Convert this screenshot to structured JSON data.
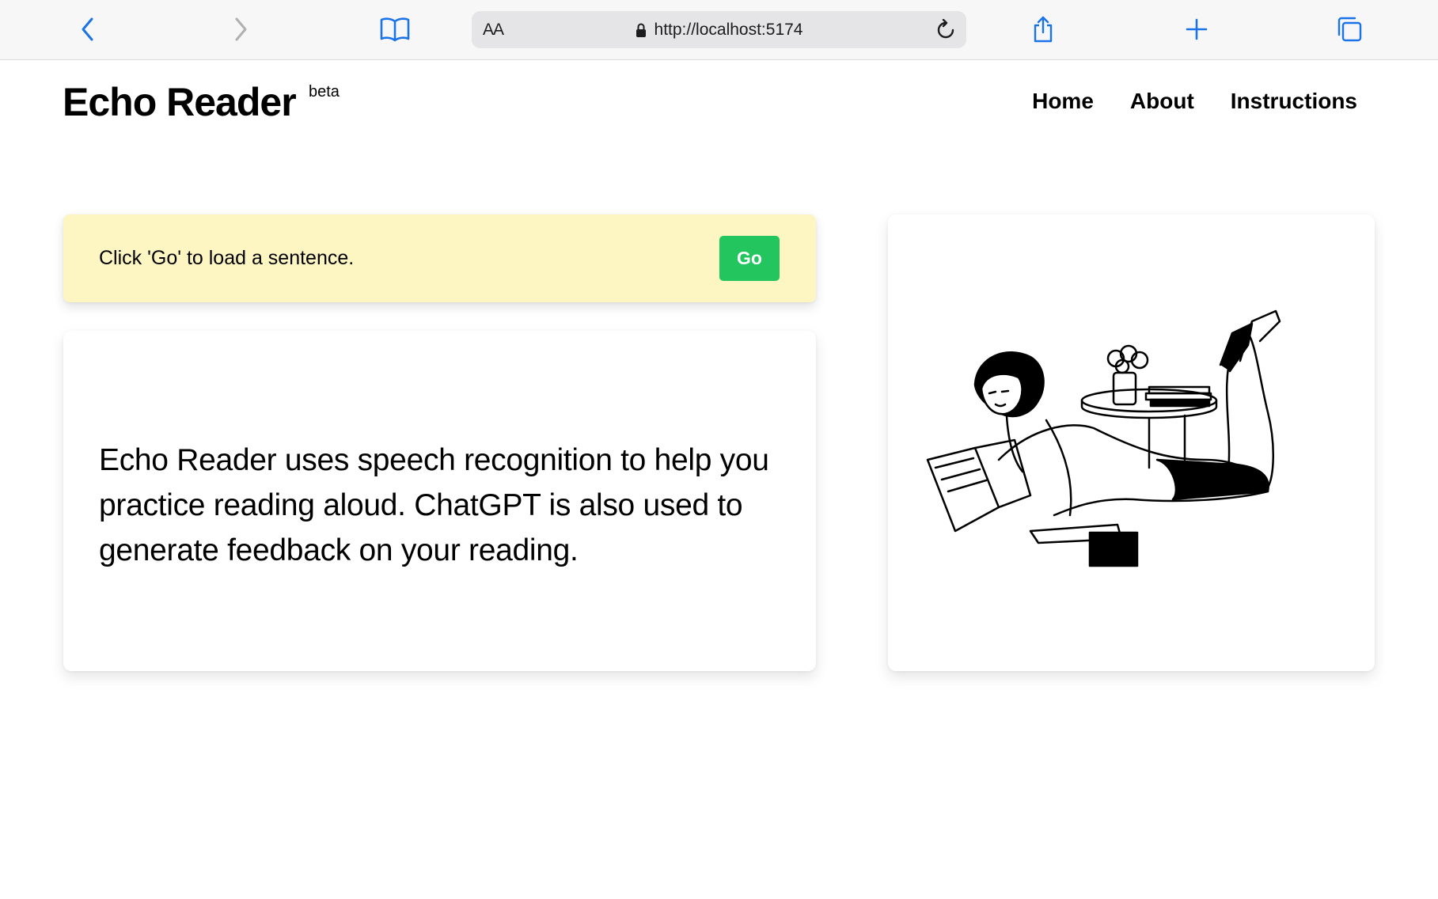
{
  "browser": {
    "aa_label": "AA",
    "url": "http://localhost:5174",
    "icons": [
      "chevron-left-icon",
      "chevron-right-icon",
      "book-icon",
      "lock-icon",
      "reload-icon",
      "share-icon",
      "plus-icon",
      "tabs-icon"
    ]
  },
  "site": {
    "title": "Echo Reader",
    "badge": "beta"
  },
  "nav": {
    "items": [
      {
        "label": "Home"
      },
      {
        "label": "About"
      },
      {
        "label": "Instructions"
      }
    ]
  },
  "prompt": {
    "text": "Click 'Go' to load a sentence.",
    "button_label": "Go",
    "background": "#fef6c2",
    "button_color": "#22c55e"
  },
  "info": {
    "text": "Echo Reader uses speech recognition to help you practice reading aloud. ChatGPT is also used to generate feedback on your reading."
  },
  "colors": {
    "toolbar_icon": "#1a73e8",
    "disabled_icon": "#b0b0b0"
  }
}
